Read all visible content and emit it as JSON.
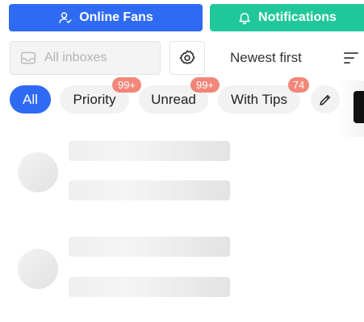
{
  "header": {
    "online_fans_label": "Online Fans",
    "notifications_label": "Notifications",
    "online_fans_icon": "user-check-icon",
    "notifications_icon": "bell-icon"
  },
  "toolbar": {
    "inbox_placeholder": "All inboxes",
    "inbox_icon": "inbox-icon",
    "settings_icon": "gear-icon",
    "sort_label": "Newest first",
    "sort_icon": "sort-lines-icon"
  },
  "filters": {
    "items": [
      {
        "label": "All",
        "active": true,
        "badge": ""
      },
      {
        "label": "Priority",
        "active": false,
        "badge": "99+"
      },
      {
        "label": "Unread",
        "active": false,
        "badge": "99+"
      },
      {
        "label": "With Tips",
        "active": false,
        "badge": "74"
      }
    ],
    "edit_icon": "pencil-icon"
  },
  "colors": {
    "primary": "#2f6bf2",
    "accent_green": "#20c79a",
    "badge": "#f28779",
    "skeleton": "#e8e8e8"
  },
  "loading": {
    "skeleton_rows": 2
  }
}
